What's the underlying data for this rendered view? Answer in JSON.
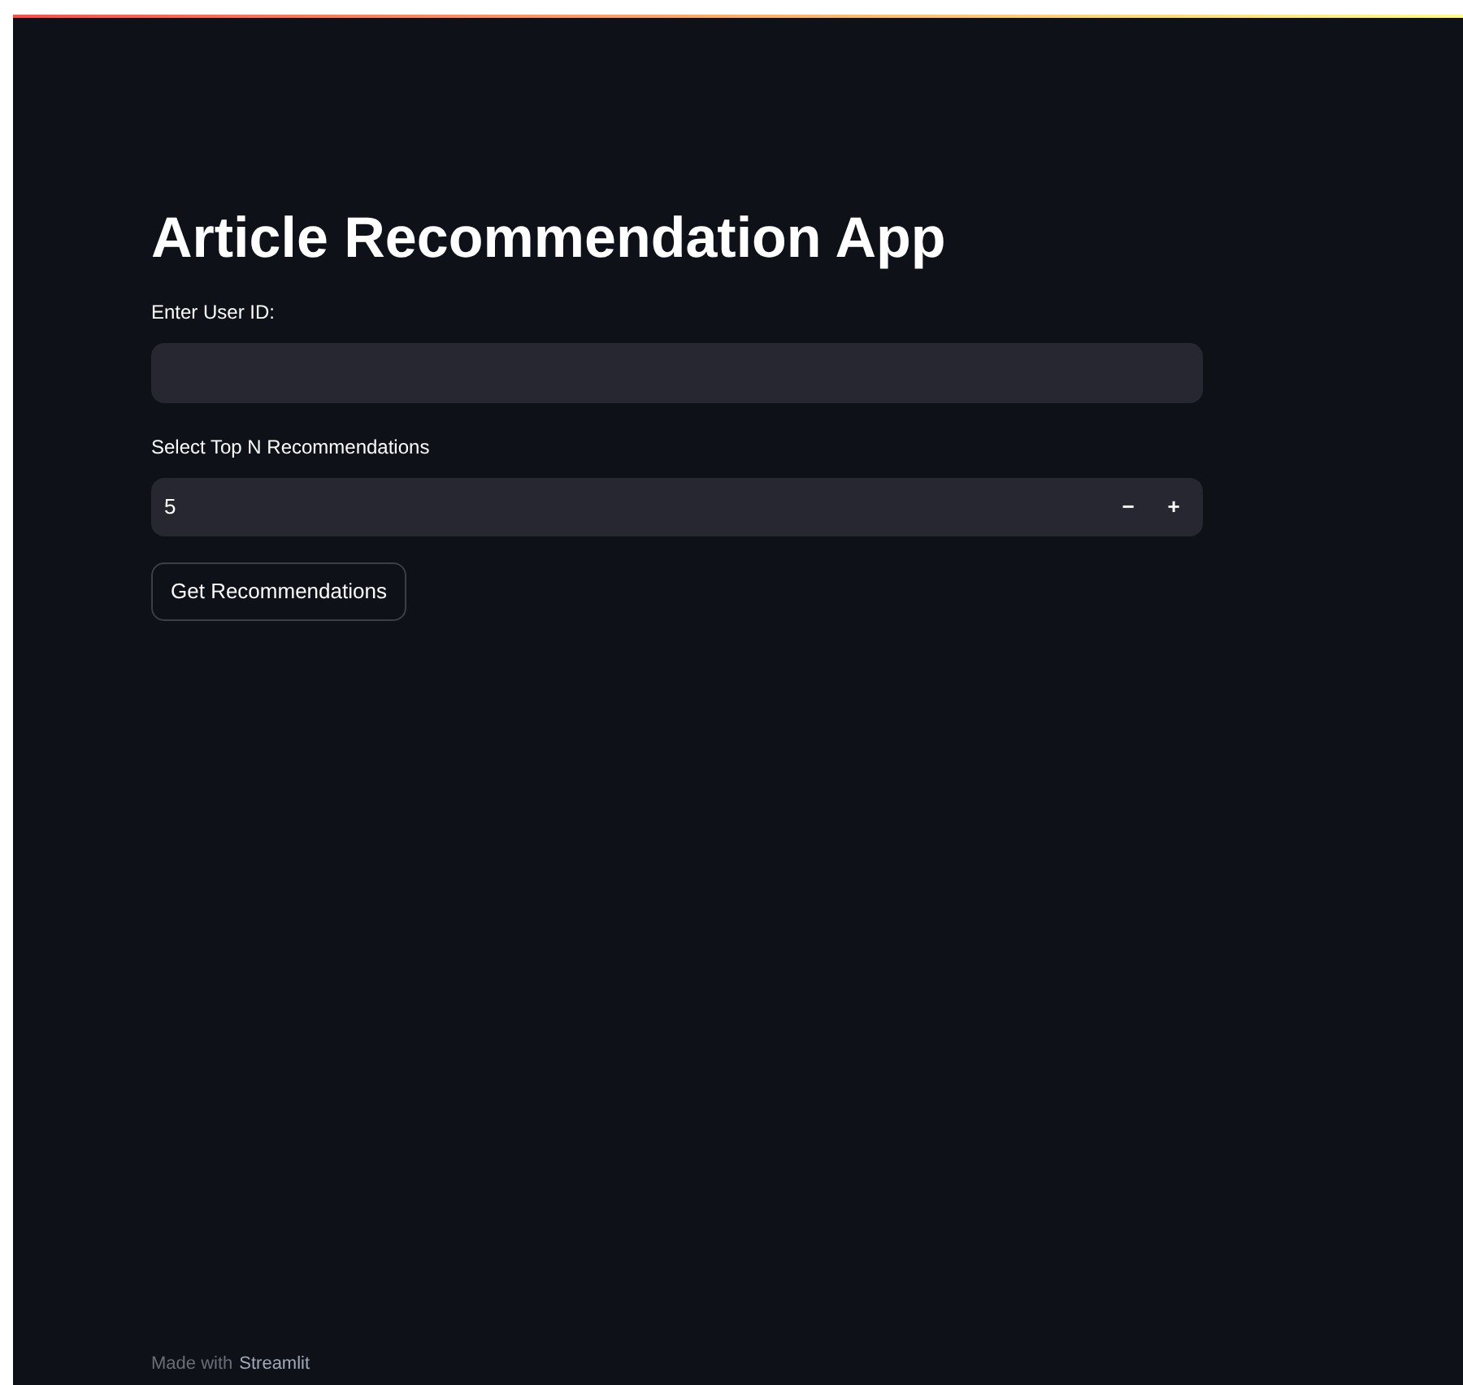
{
  "title": "Article Recommendation App",
  "user_id_field": {
    "label": "Enter User ID:"
  },
  "top_n_field": {
    "label": "Select Top N Recommendations",
    "value": "5",
    "decrement": "−",
    "increment": "+"
  },
  "submit_button": "Get Recommendations",
  "footer": {
    "prefix": "Made with",
    "link": "Streamlit"
  }
}
